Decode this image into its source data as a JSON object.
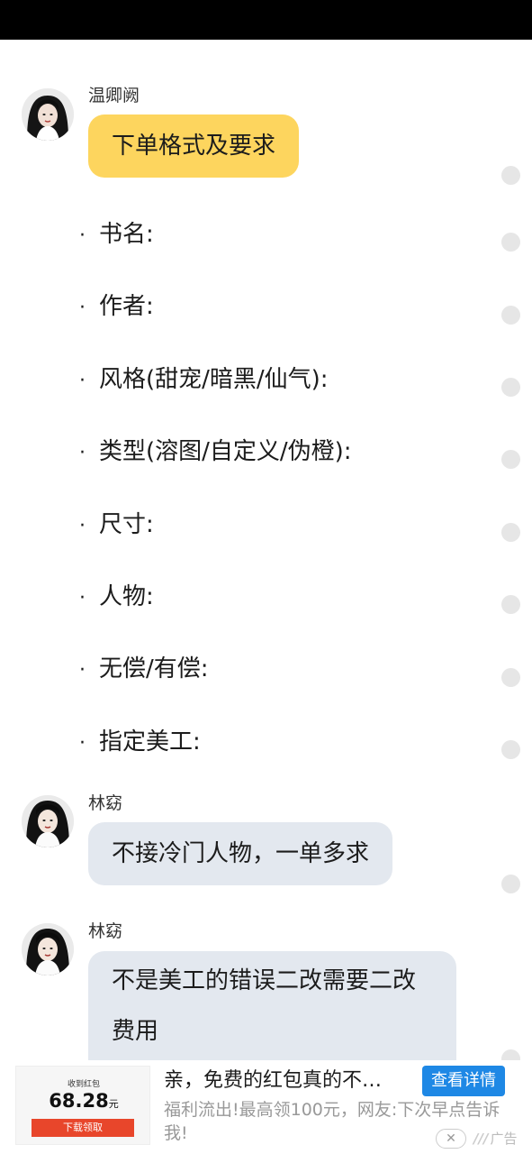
{
  "messages": [
    {
      "sender": "温卿阙",
      "text": "下单格式及要求"
    },
    {
      "sender": "林窈",
      "text": "不接冷门人物，一单多求"
    },
    {
      "sender": "林窈",
      "text": "不是美工的错误二改需要二改费用"
    }
  ],
  "bullet_symbol": "·",
  "order_fields": [
    "书名:",
    "作者:",
    "风格(甜宠/暗黑/仙气):",
    "类型(溶图/自定义/伪橙):",
    "尺寸:",
    "人物:",
    "无偿/有偿:",
    "指定美工:"
  ],
  "icons": {
    "avatar": "avatar-icon",
    "side_marker": "status-dot-icon",
    "ad_close": "close-icon"
  },
  "colors": {
    "highlight_bubble": "#fdd55e",
    "normal_bubble": "#e3e8ef",
    "ad_cta": "#1e88e5",
    "ad_thumb_button": "#e8462b"
  },
  "ad": {
    "thumb_caption": "收到红包",
    "thumb_amount": "68.28",
    "thumb_unit": "元",
    "thumb_button": "下载领取",
    "title": "亲，免费的红包真的不…",
    "cta": "查看详情",
    "description": "福利流出!最高领100元，网友:下次早点告诉我!",
    "close": "✕",
    "label": "广告"
  }
}
